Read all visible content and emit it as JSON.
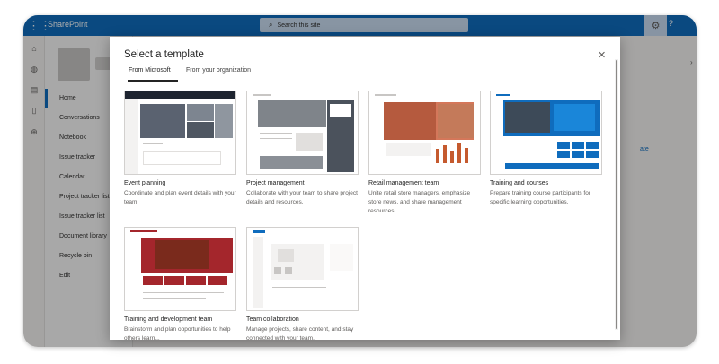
{
  "suite": {
    "app_name": "SharePoint",
    "search_placeholder": "Search this site",
    "help": "?"
  },
  "nav": {
    "items": [
      {
        "label": "Home"
      },
      {
        "label": "Conversations"
      },
      {
        "label": "Notebook"
      },
      {
        "label": "Issue tracker"
      },
      {
        "label": "Calendar"
      },
      {
        "label": "Project tracker list"
      },
      {
        "label": "Issue tracker list"
      },
      {
        "label": "Document library"
      },
      {
        "label": "Recycle bin"
      },
      {
        "label": "Edit"
      }
    ]
  },
  "page_right_text": "ate",
  "dialog": {
    "title": "Select a template",
    "tabs": [
      {
        "label": "From Microsoft"
      },
      {
        "label": "From your organization"
      }
    ],
    "templates": [
      {
        "title": "Event planning",
        "description": "Coordinate and plan event details with your team."
      },
      {
        "title": "Project management",
        "description": "Collaborate with your team to share project details and resources."
      },
      {
        "title": "Retail management team",
        "description": "Unite retail store managers, emphasize store news, and share management resources."
      },
      {
        "title": "Training and courses",
        "description": "Prepare training course participants for specific learning opportunities."
      },
      {
        "title": "Training and development team",
        "description": "Brainstorm and plan opportunities to help others learn..."
      },
      {
        "title": "Team collaboration",
        "description": "Manage projects, share content, and stay connected with your team."
      }
    ]
  },
  "colors": {
    "brand": "#0f6cbd",
    "overlay": "rgba(0,0,0,0.32)"
  }
}
